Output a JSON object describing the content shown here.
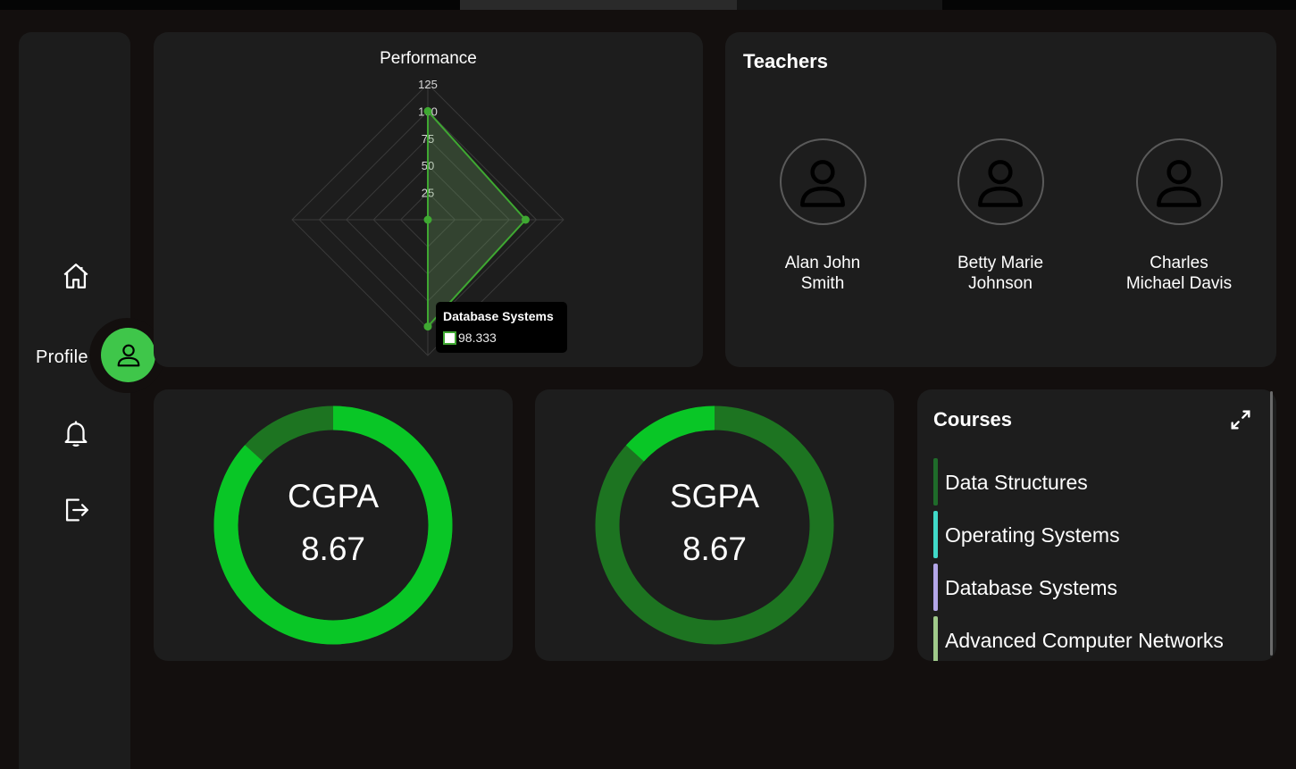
{
  "sidebar": {
    "items": [
      {
        "icon": "home-icon",
        "label": ""
      },
      {
        "icon": "user-icon",
        "label": "Profile",
        "active": true
      },
      {
        "icon": "bell-icon",
        "label": ""
      },
      {
        "icon": "logout-icon",
        "label": ""
      }
    ],
    "accent": "#3fc64a"
  },
  "performance": {
    "title": "Performance",
    "tooltip": {
      "label": "Database Systems",
      "value": "98.333"
    }
  },
  "chart_data": {
    "type": "radar",
    "title": "Performance",
    "axes": [
      "Data Structures",
      "Operating Systems",
      "Database Systems",
      "Advanced Computer Networks"
    ],
    "values": [
      100,
      90,
      98.333,
      0
    ],
    "scale": {
      "min": 0,
      "max": 125,
      "ticks": [
        25,
        50,
        75,
        100,
        125
      ]
    },
    "color": "#3fa832"
  },
  "teachers": {
    "title": "Teachers",
    "list": [
      {
        "name_line1": "Alan John",
        "name_line2": "Smith"
      },
      {
        "name_line1": "Betty Marie",
        "name_line2": "Johnson"
      },
      {
        "name_line1": "Charles",
        "name_line2": "Michael Davis"
      }
    ]
  },
  "cgpa": {
    "label": "CGPA",
    "value": "8.67",
    "fraction": 0.867
  },
  "sgpa": {
    "label": "SGPA",
    "value": "8.67",
    "fraction": 0.133
  },
  "gauge_colors": {
    "primary": "#09c626",
    "track": "#1d7421"
  },
  "courses": {
    "title": "Courses",
    "expand_icon": "expand-icon",
    "items": [
      {
        "name": "Data Structures",
        "color": "#1f6b2a"
      },
      {
        "name": "Operating Systems",
        "color": "#40d9c8"
      },
      {
        "name": "Database Systems",
        "color": "#b3a6e8"
      },
      {
        "name": "Advanced Computer Networks",
        "color": "#9fc98a"
      }
    ]
  }
}
